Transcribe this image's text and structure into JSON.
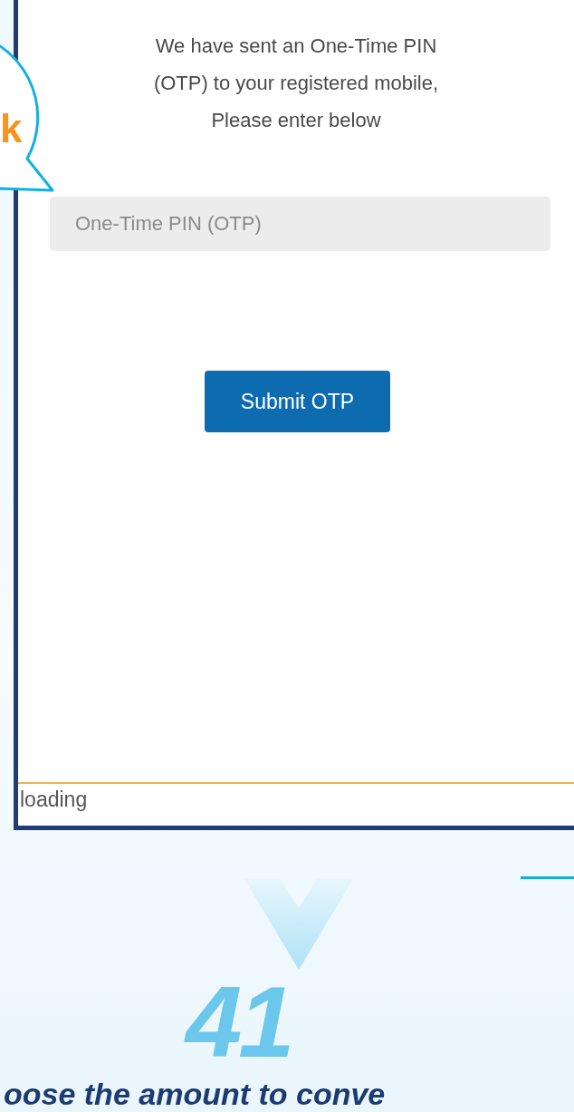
{
  "bubble": {
    "text": "k"
  },
  "screen": {
    "message_lines": [
      "We have sent an One-Time PIN",
      "(OTP) to your registered mobile,",
      "Please enter below"
    ],
    "otp_field": {
      "placeholder": "One-Time PIN (OTP)"
    },
    "submit_button": "Submit OTP",
    "status": "loading"
  },
  "step": {
    "number": "41",
    "caption": "oose the amount to conve"
  }
}
